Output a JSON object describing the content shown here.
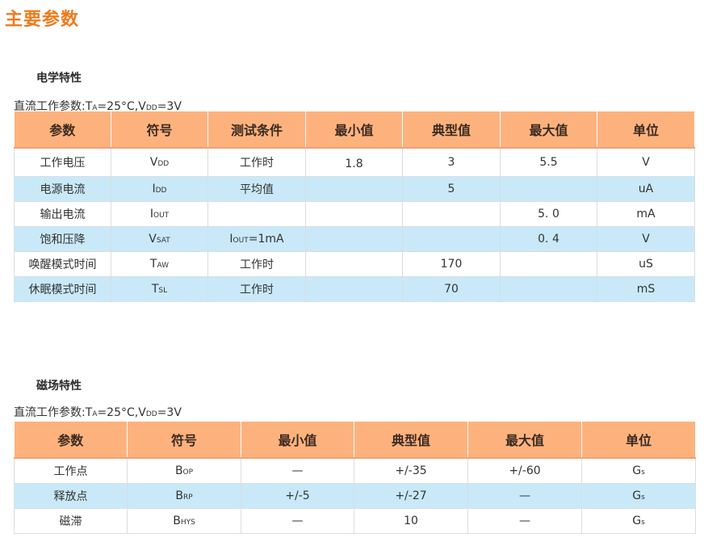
{
  "page": {
    "title": "主要参数"
  },
  "electrical": {
    "title": "电学特性",
    "condition": {
      "prefix": "直流工作参数:T",
      "ta_sub": "A",
      "mid": "=25°C,V",
      "vdd_sub": "DD",
      "suffix": "=3V"
    },
    "columns": [
      "参数",
      "符号",
      "测试条件",
      "最小值",
      "典型值",
      "最大值",
      "单位"
    ],
    "rows": [
      {
        "param": "工作电压",
        "sym": "V",
        "sym_sub": "DD",
        "cond_main": "工作时",
        "cond_sub": "",
        "cond_tail": "",
        "min": "1.8",
        "typ": "3",
        "max": "5.5",
        "unit": "V"
      },
      {
        "param": "电源电流",
        "sym": "I",
        "sym_sub": "DD",
        "cond_main": "平均值",
        "cond_sub": "",
        "cond_tail": "",
        "min": "",
        "typ": "5",
        "max": "",
        "unit": "uA"
      },
      {
        "param": "输出电流",
        "sym": "I",
        "sym_sub": "OUT",
        "cond_main": "",
        "cond_sub": "",
        "cond_tail": "",
        "min": "",
        "typ": "",
        "max": "5. 0",
        "unit": "mA"
      },
      {
        "param": "饱和压降",
        "sym": "V",
        "sym_sub": "SAT",
        "cond_main": "I",
        "cond_sub": "OUT",
        "cond_tail": "=1mA",
        "min": "",
        "typ": "",
        "max": "0. 4",
        "unit": "V"
      },
      {
        "param": "唤醒模式时间",
        "sym": "T",
        "sym_sub": "AW",
        "cond_main": "工作时",
        "cond_sub": "",
        "cond_tail": "",
        "min": "",
        "typ": "170",
        "max": "",
        "unit": "uS"
      },
      {
        "param": "休眠模式时间",
        "sym": "T",
        "sym_sub": "SL",
        "cond_main": "工作时",
        "cond_sub": "",
        "cond_tail": "",
        "min": "",
        "typ": "70",
        "max": "",
        "unit": "mS"
      }
    ]
  },
  "magnetic": {
    "title": "磁场特性",
    "condition": {
      "prefix": "直流工作参数:T",
      "ta_sub": "A",
      "mid": "=25°C,V",
      "vdd_sub": "DD",
      "suffix": "=3V"
    },
    "columns": [
      "参数",
      "符号",
      "最小值",
      "典型值",
      "最大值",
      "单位"
    ],
    "rows": [
      {
        "param": "工作点",
        "sym": "B",
        "sym_sub": "OP",
        "min": "—",
        "typ": "+/-35",
        "max": "+/-60",
        "unit": "G",
        "unit_sub": "s"
      },
      {
        "param": "释放点",
        "sym": "B",
        "sym_sub": "RP",
        "min": "+/-5",
        "typ": "+/-27",
        "max": "—",
        "unit": "G",
        "unit_sub": "s"
      },
      {
        "param": "磁滞",
        "sym": "B",
        "sym_sub": "HYS",
        "min": "—",
        "typ": "10",
        "max": "—",
        "unit": "G",
        "unit_sub": "s"
      }
    ]
  },
  "colors": {
    "title_orange": "#ee7a1c",
    "header_bg": "#fdb27e",
    "row_alt_bg": "#c9e9f8"
  }
}
